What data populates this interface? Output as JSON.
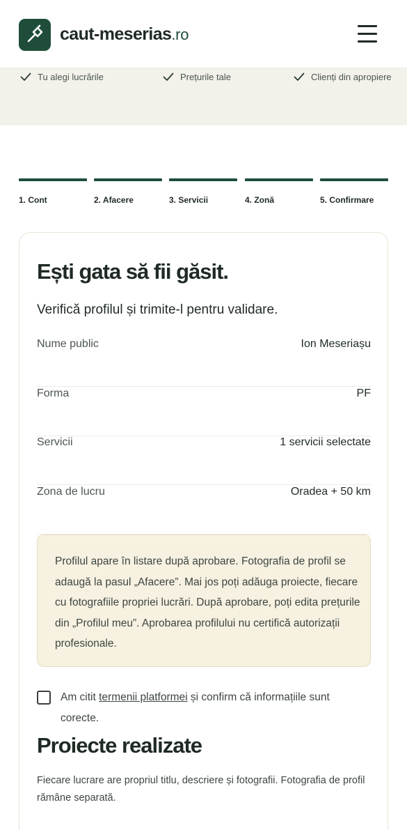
{
  "header": {
    "brand_main": "caut-meserias",
    "brand_tld": ".ro",
    "logo_icon": "hammer-icon",
    "menu_icon": "hamburger-menu-icon"
  },
  "benefits": [
    {
      "icon": "check-icon",
      "label": "Tu alegi lucrările"
    },
    {
      "icon": "check-icon",
      "label": "Prețurile tale"
    },
    {
      "icon": "check-icon",
      "label": "Clienți din apropiere"
    }
  ],
  "steps": [
    {
      "label": "1. Cont"
    },
    {
      "label": "2. Afacere"
    },
    {
      "label": "3. Servicii"
    },
    {
      "label": "4. Zonă"
    },
    {
      "label": "5. Confirmare"
    }
  ],
  "card": {
    "title": "Ești gata să fii găsit.",
    "subtitle": "Verifică profilul și trimite-l pentru validare.",
    "summary": [
      {
        "key": "Nume public",
        "value": "Ion Meseriașu"
      },
      {
        "key": "Forma",
        "value": "PF"
      },
      {
        "key": "Servicii",
        "value": "1 servicii selectate"
      },
      {
        "key": "Zona de lucru",
        "value": "Oradea + 50 km"
      }
    ],
    "notice": "Profilul apare în listare după aprobare. Fotografia de profil se adaugă la pasul „Afacere”. Mai jos poți adăuga proiecte, fiecare cu fotografiile propriei lucrări. După aprobare, poți edita prețurile din „Profilul meu”. Aprobarea profilului nu certifică autorizații profesionale.",
    "consent": {
      "checked": false,
      "before": "Am citit ",
      "link": "termenii platformei",
      "after": " și confirm că informațiile sunt corecte."
    },
    "projects_title": "Proiecte realizate",
    "projects_desc": "Fiecare lucrare are propriul titlu, descriere și fotografii. Fotografia de profil rămâne separată."
  },
  "colors": {
    "brand": "#1f4d3a",
    "text": "#1f2a24",
    "muted": "#4b5550",
    "benefit_bg": "#f2f2ea",
    "notice_bg": "#f7f1e1",
    "notice_border": "#e8dcbc"
  }
}
